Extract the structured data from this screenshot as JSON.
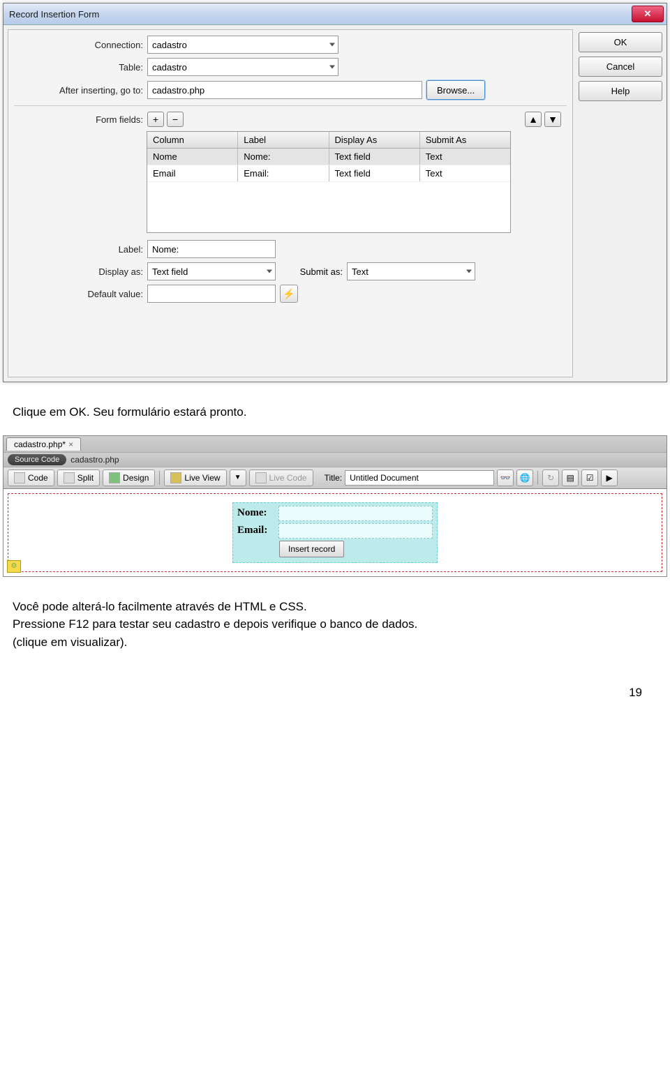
{
  "dialog": {
    "title": "Record Insertion Form",
    "buttons": {
      "ok": "OK",
      "cancel": "Cancel",
      "help": "Help"
    },
    "labels": {
      "connection": "Connection:",
      "table": "Table:",
      "after": "After inserting, go to:",
      "fields": "Form fields:",
      "label": "Label:",
      "displayAs": "Display as:",
      "submitAs": "Submit as:",
      "defaultValue": "Default value:"
    },
    "values": {
      "connection": "cadastro",
      "table": "cadastro",
      "after": "cadastro.php",
      "browse": "Browse...",
      "label": "Nome:",
      "displayAs": "Text field",
      "submitAs": "Text",
      "defaultValue": ""
    },
    "grid": {
      "headers": {
        "column": "Column",
        "label": "Label",
        "displayAs": "Display As",
        "submitAs": "Submit As"
      },
      "rows": [
        {
          "column": "Nome",
          "label": "Nome:",
          "displayAs": "Text field",
          "submitAs": "Text"
        },
        {
          "column": "Email",
          "label": "Email:",
          "displayAs": "Text field",
          "submitAs": "Text"
        }
      ]
    },
    "icons": {
      "plus": "+",
      "minus": "−",
      "up": "▲",
      "down": "▼",
      "bolt": "⚡"
    }
  },
  "text": {
    "line1": "Clique em OK. Seu formulário estará pronto.",
    "line2": "Você pode alterá-lo facilmente através de HTML e CSS.",
    "line3": "Pressione F12 para testar seu cadastro e depois verifique o banco de dados.",
    "line4": "(clique em visualizar)."
  },
  "dw": {
    "tab": "cadastro.php*",
    "source": "Source Code",
    "related": "cadastro.php",
    "toolbar": {
      "code": "Code",
      "split": "Split",
      "design": "Design",
      "liveView": "Live View",
      "liveCode": "Live Code",
      "titleLabel": "Title:",
      "titleValue": "Untitled Document"
    },
    "form": {
      "nome": "Nome:",
      "email": "Email:",
      "submit": "Insert record"
    }
  },
  "pageNumber": "19"
}
